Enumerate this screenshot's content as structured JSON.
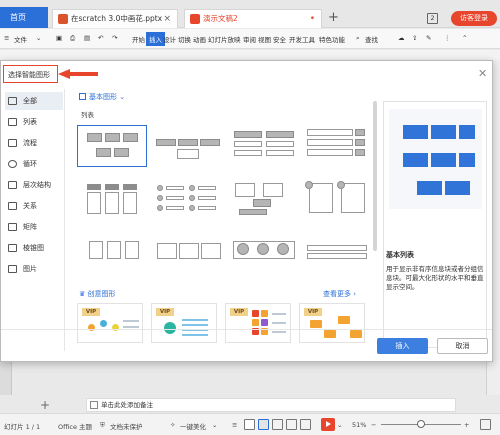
{
  "app": {
    "home_tab": "首页",
    "tabs": [
      {
        "label": "在scratch 3.0中画花.pptx"
      },
      {
        "label": "演示文稿2"
      }
    ],
    "page_count": "2",
    "login_button": "访客登录"
  },
  "ribbon": {
    "file_menu": "文件",
    "tabs": [
      "开始",
      "插入",
      "设计",
      "切换",
      "动画",
      "幻灯片放映",
      "审阅",
      "视图",
      "安全",
      "开发工具",
      "特色功能"
    ],
    "active_tab": "插入",
    "search": "查找"
  },
  "dialog": {
    "title": "选择智能图形",
    "categories": [
      "全部",
      "列表",
      "流程",
      "循环",
      "层次结构",
      "关系",
      "矩阵",
      "棱锥图",
      "图片"
    ],
    "selected_category": "全部",
    "section_header": "基本图形",
    "section_sub": "列表",
    "creative_label": "创意图形",
    "more_label": "查看更多",
    "vip_badge": "VIP",
    "preview_name": "基本列表",
    "preview_desc": "用于显示非有序信息块或者分组信息块。可最大化形状的水平和垂直显示空间。",
    "insert_button": "插入",
    "cancel_button": "取消"
  },
  "notes": {
    "placeholder": "单击此处添加备注"
  },
  "status": {
    "slide_info": "幻灯片 1 / 1",
    "theme": "Office 主题",
    "doc_protect": "文档未保护",
    "beautify": "一键美化",
    "zoom": "51%"
  },
  "colors": {
    "accent": "#2b6fd8",
    "vip": "#f1d08a",
    "login": "#e8452d"
  }
}
